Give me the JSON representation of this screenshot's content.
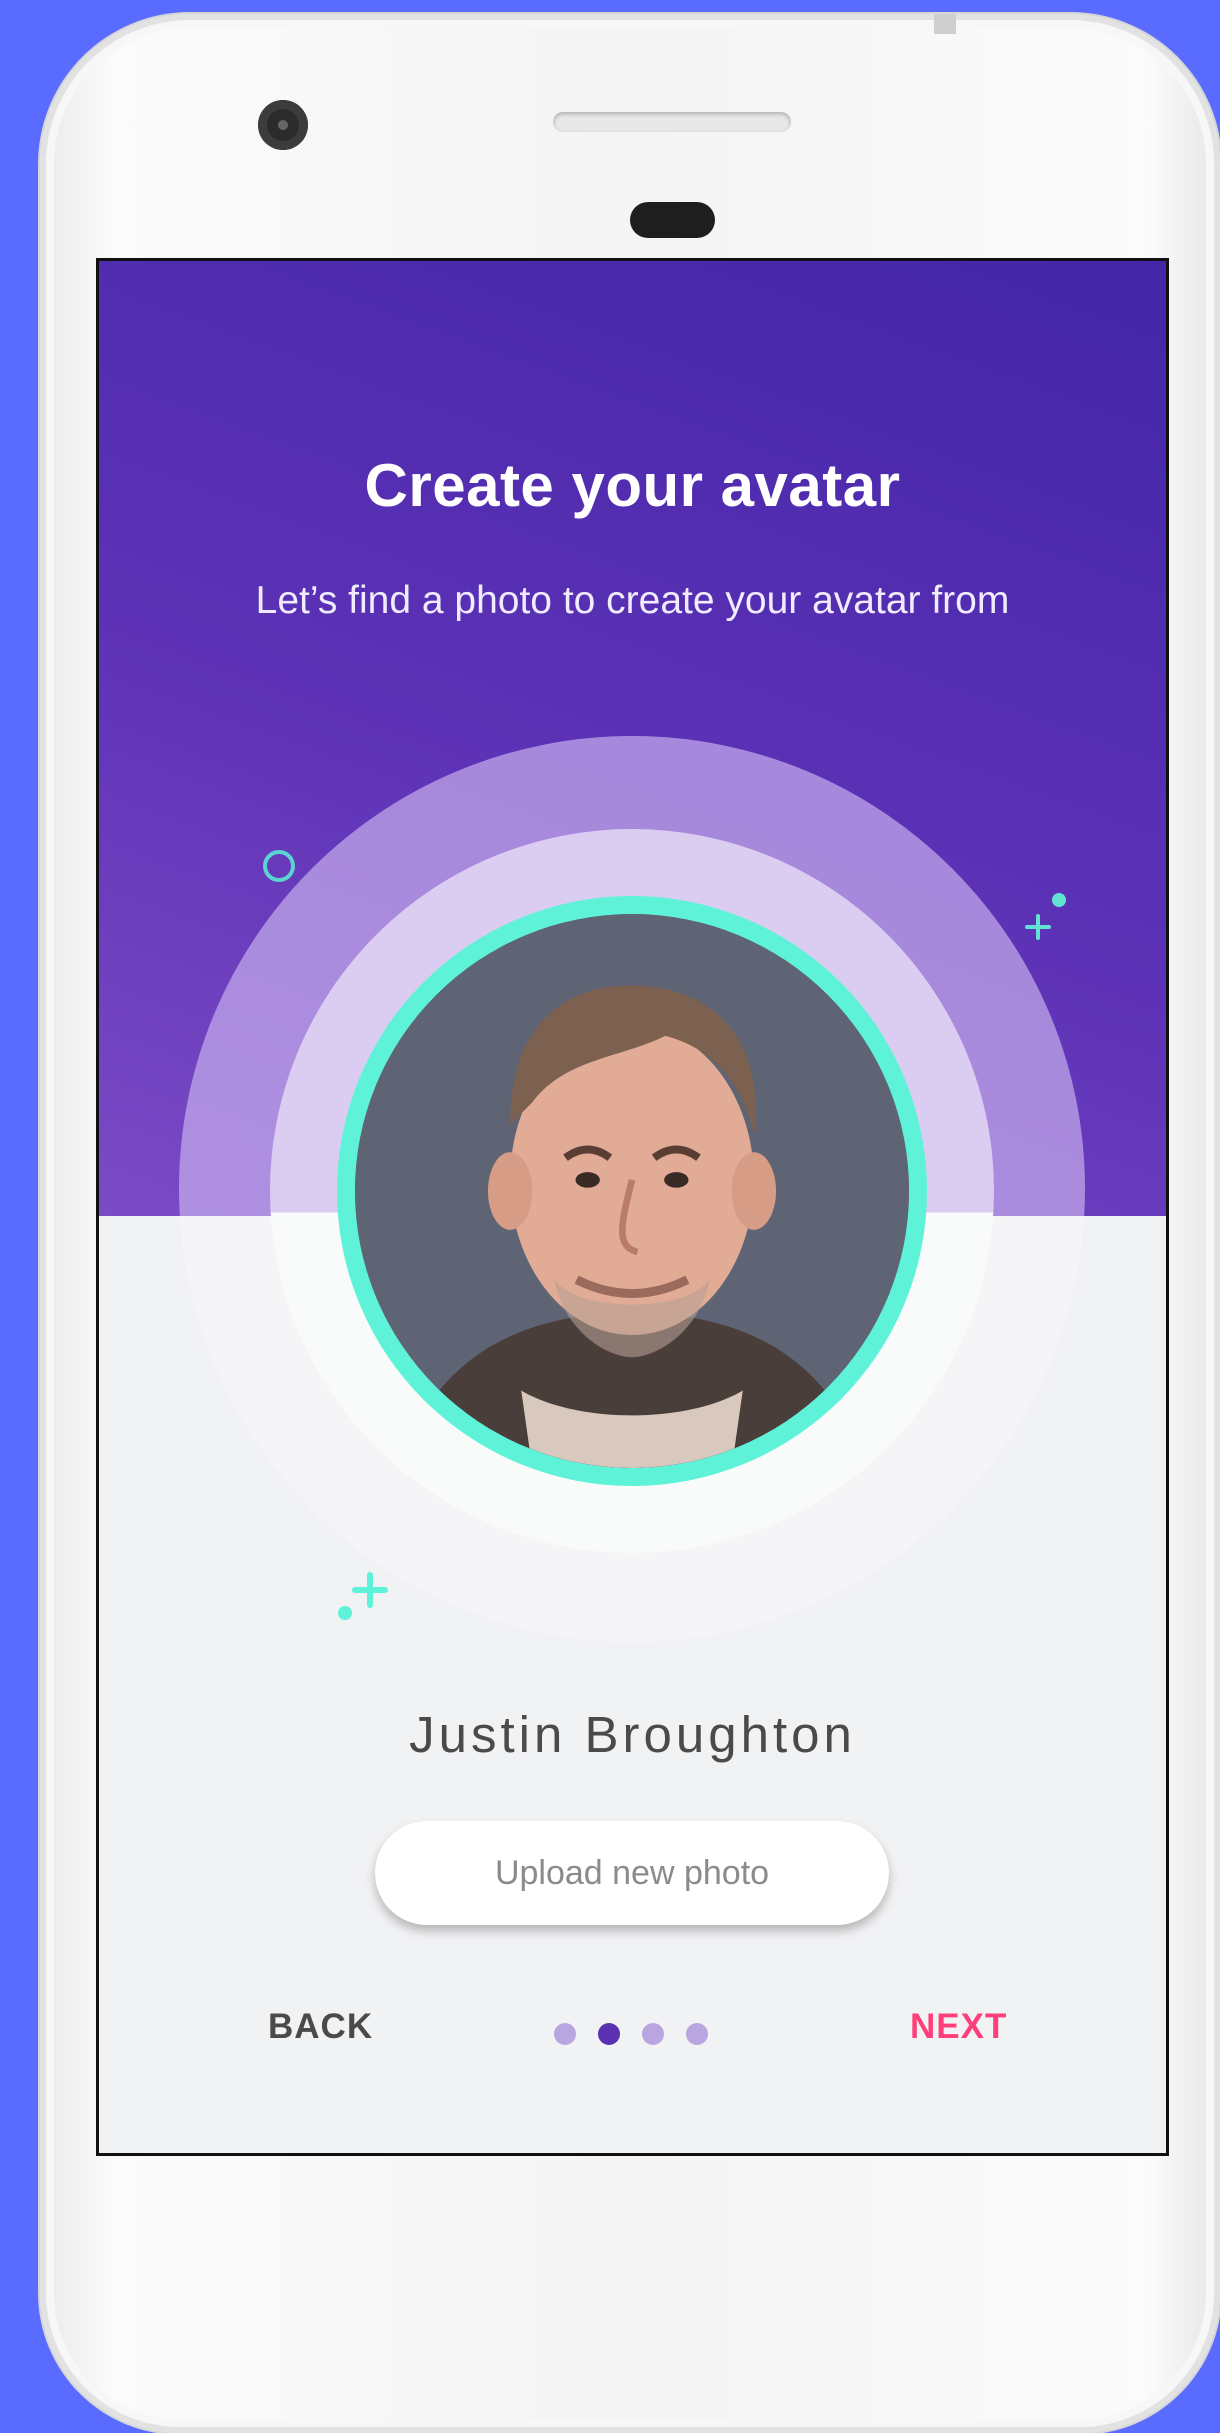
{
  "header": {
    "title": "Create your avatar",
    "subtitle": "Let’s find a photo to create your avatar from"
  },
  "profile": {
    "name": "Justin Broughton",
    "upload_label": "Upload new photo"
  },
  "navigation": {
    "back_label": "BACK",
    "next_label": "NEXT",
    "pages": 4,
    "current_page": 2
  },
  "colors": {
    "background": "#5a6bff",
    "hero_gradient_top": "#4326a8",
    "hero_gradient_bottom": "#7a4bc6",
    "avatar_ring": "#5ef3d8",
    "next_accent": "#ff3f7a",
    "dot_active": "#5a31b0",
    "dot_inactive": "#b9a6e0"
  },
  "icons": [
    "circle-outline-icon",
    "plus-icon",
    "dot-icon"
  ]
}
